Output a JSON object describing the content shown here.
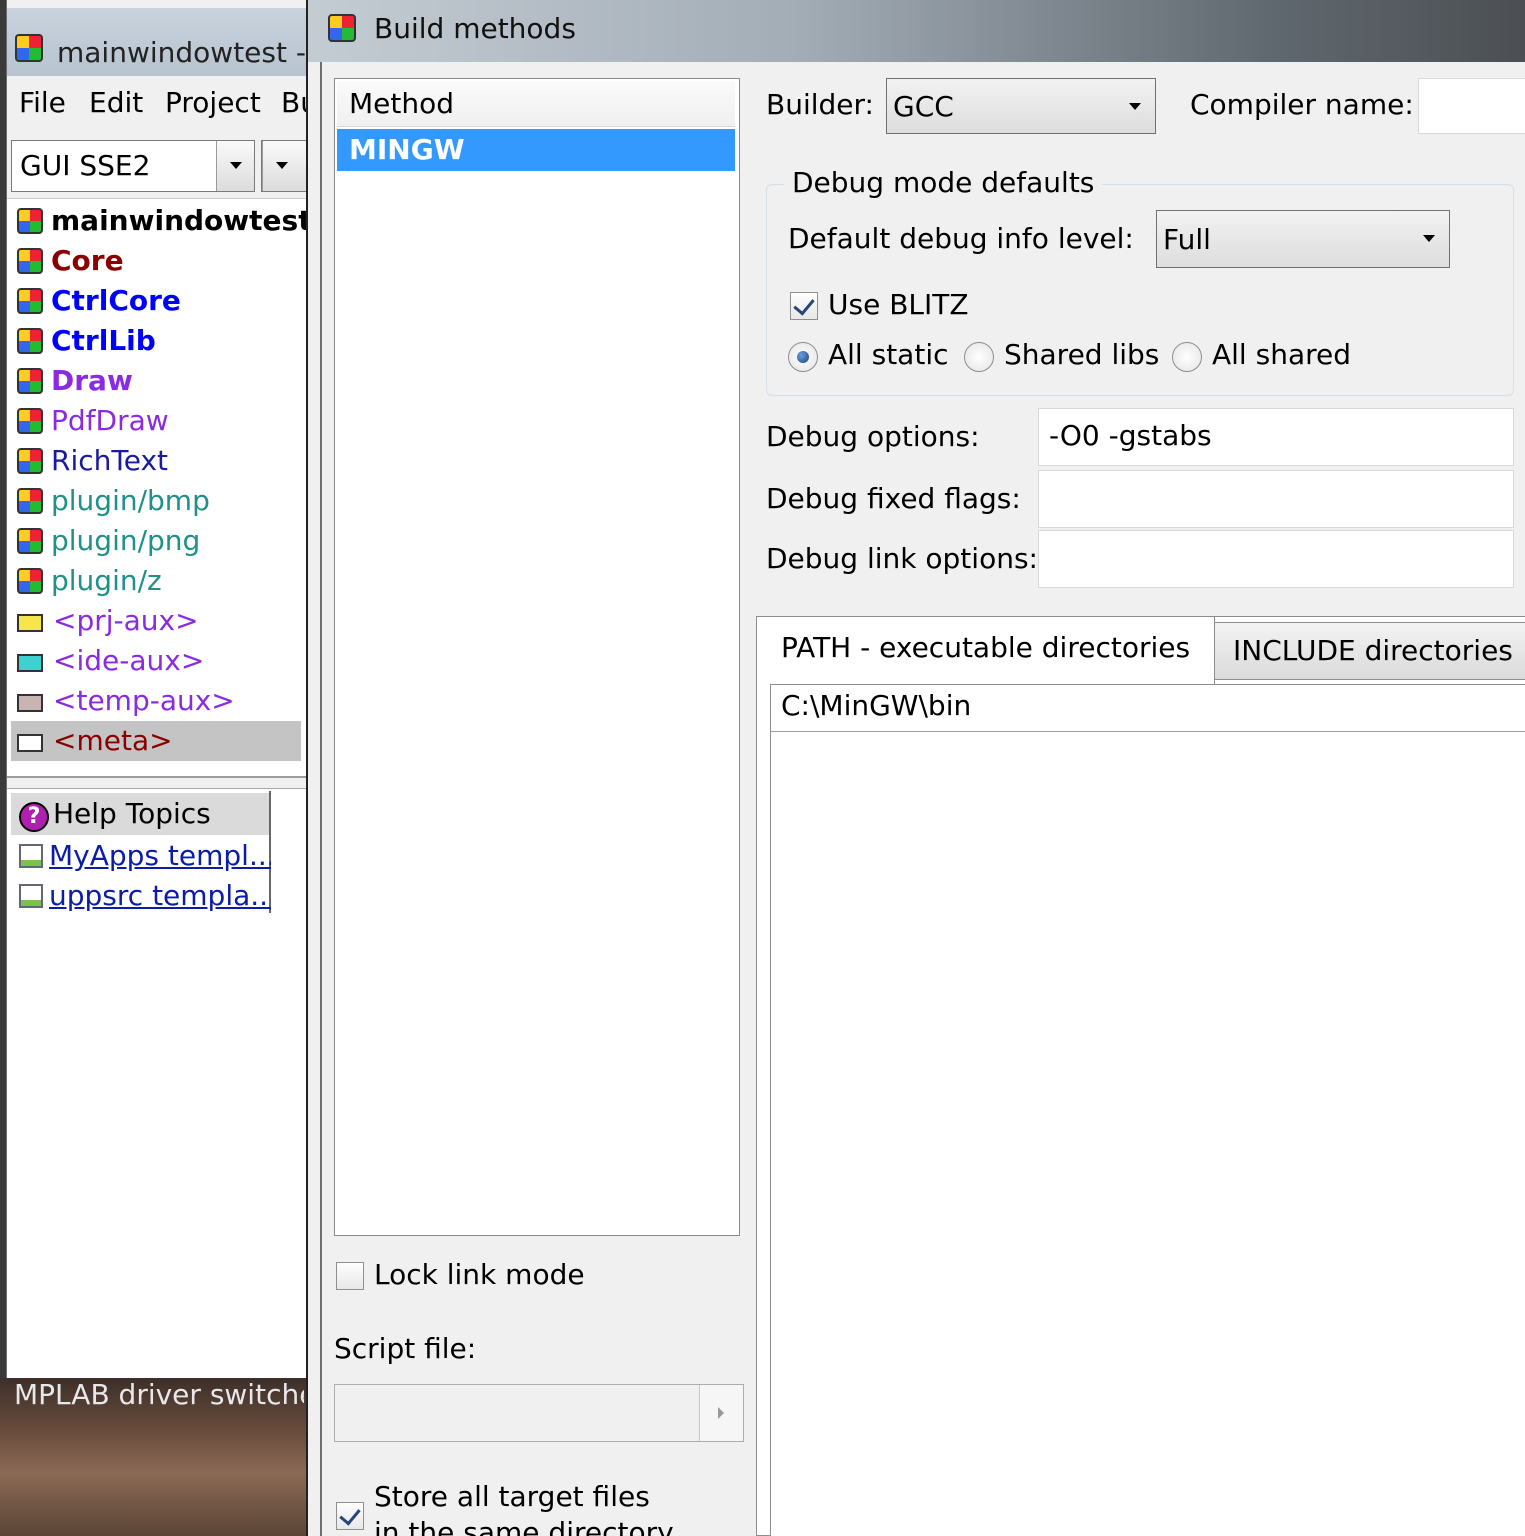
{
  "main_window": {
    "title": "mainwindowtest - (",
    "menu": [
      "File",
      "Edit",
      "Project",
      "Bu"
    ],
    "toolbar": {
      "build_mode": "GUI SSE2"
    },
    "packages": [
      {
        "label": "mainwindowtest",
        "color": "#000000",
        "bold": true
      },
      {
        "label": "Core",
        "color": "#8b0000",
        "bold": true
      },
      {
        "label": "CtrlCore",
        "color": "#0000ff",
        "bold": true
      },
      {
        "label": "CtrlLib",
        "color": "#0000ff",
        "bold": true
      },
      {
        "label": "Draw",
        "color": "#8a2be2",
        "bold": true
      },
      {
        "label": "PdfDraw",
        "color": "#8a2be2",
        "bold": false
      },
      {
        "label": "RichText",
        "color": "#1a1aa0",
        "bold": false
      },
      {
        "label": "plugin/bmp",
        "color": "#20908a",
        "bold": false
      },
      {
        "label": "plugin/png",
        "color": "#20908a",
        "bold": false
      },
      {
        "label": "plugin/z",
        "color": "#20908a",
        "bold": false
      },
      {
        "label": "<prj-aux>",
        "color": "#8a2be2",
        "icon_color": "#f7e64a"
      },
      {
        "label": "<ide-aux>",
        "color": "#8a2be2",
        "icon_color": "#3fd0d0"
      },
      {
        "label": "<temp-aux>",
        "color": "#8a2be2",
        "icon_color": "#c9b3b3"
      },
      {
        "label": "<meta>",
        "color": "#8b0000",
        "icon_color": "#ffffff"
      }
    ],
    "help": {
      "header": "Help Topics",
      "links": [
        "MyApps templ...",
        "uppsrc templa..."
      ]
    }
  },
  "desktop": {
    "label": "MPLAB driver switcher"
  },
  "dialog": {
    "title": "Build methods",
    "method_header": "Method",
    "methods": [
      "MINGW"
    ],
    "lock_link_mode": {
      "label": "Lock link mode",
      "checked": false
    },
    "script_file_label": "Script file:",
    "store_all_target": {
      "label": "Store all target files",
      "label_line2": "in the same directory",
      "checked": true
    },
    "builder_label": "Builder:",
    "builder_value": "GCC",
    "compiler_name_label": "Compiler name:",
    "debug_defaults": {
      "title": "Debug mode defaults",
      "info_level_label": "Default debug info level:",
      "info_level_value": "Full",
      "use_blitz": {
        "label": "Use BLITZ",
        "checked": true
      },
      "link_modes": [
        "All static",
        "Shared libs",
        "All shared"
      ],
      "link_mode_selected": 0
    },
    "debug_options_label": "Debug options:",
    "debug_options_value": "-O0 -gstabs",
    "debug_fixed_flags_label": "Debug fixed flags:",
    "debug_link_options_label": "Debug link options:",
    "tabs": [
      "PATH - executable directories",
      "INCLUDE directories"
    ],
    "active_tab": 0,
    "paths": [
      "C:\\MinGW\\bin"
    ]
  }
}
